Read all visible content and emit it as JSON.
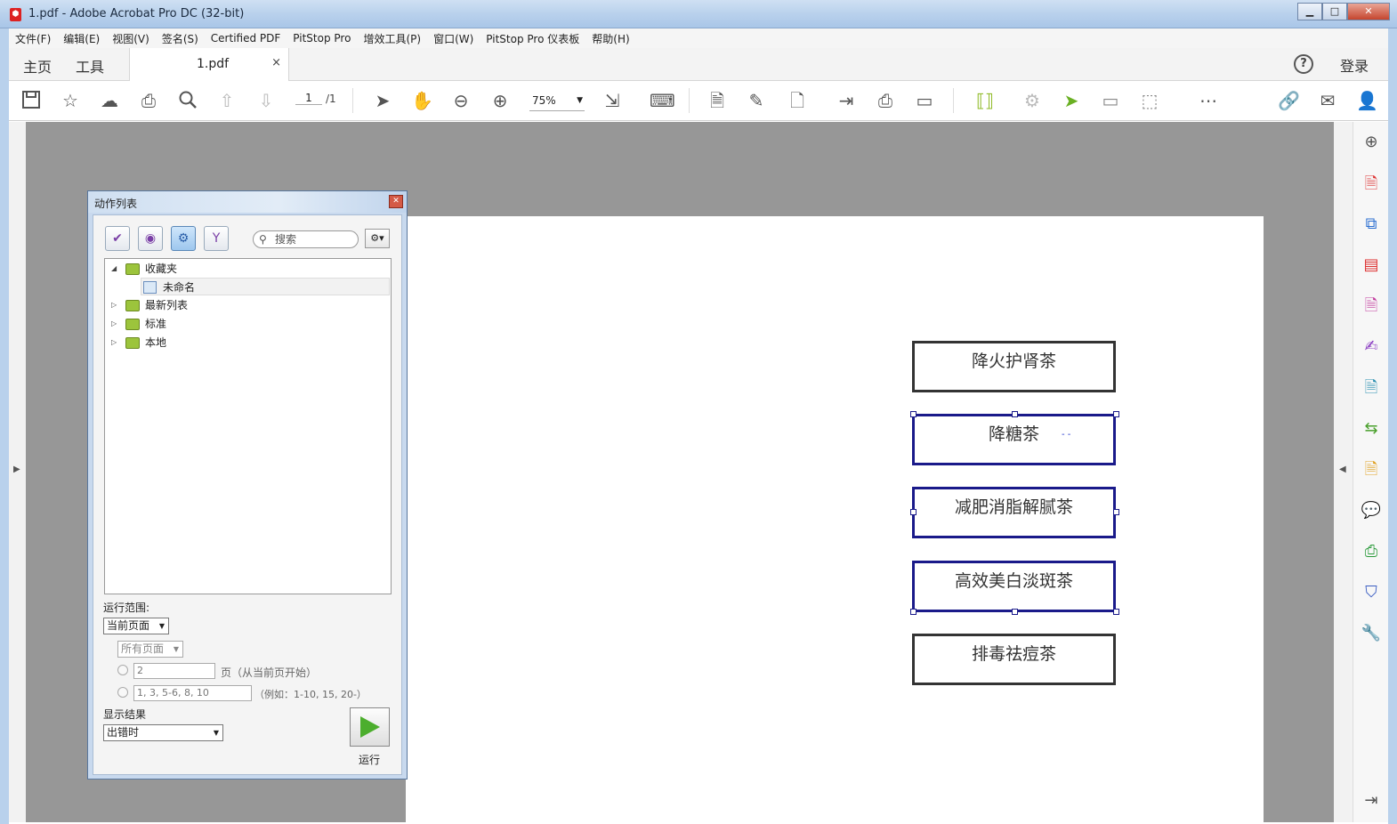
{
  "window": {
    "title": "1.pdf - Adobe Acrobat Pro DC (32-bit)",
    "min": "▁",
    "max": "□",
    "close": "✕"
  },
  "menu": [
    "文件(F)",
    "编辑(E)",
    "视图(V)",
    "签名(S)",
    "Certified PDF",
    "PitStop Pro",
    "增效工具(P)",
    "窗口(W)",
    "PitStop Pro 仪表板",
    "帮助(H)"
  ],
  "tabs": {
    "home": "主页",
    "tools": "工具",
    "doc": "1.pdf",
    "doc_close": "×",
    "help": "?",
    "login": "登录"
  },
  "toolbar": {
    "page_current": "1",
    "page_total": "/1",
    "zoom": "75%"
  },
  "page": {
    "boxes": [
      "降火护肾茶",
      "降糖茶",
      "减肥消脂解腻茶",
      "高效美白淡斑茶",
      "排毒祛痘茶"
    ]
  },
  "dialog": {
    "title": "动作列表",
    "close": "✕",
    "search_placeholder": "搜索",
    "tree": [
      {
        "label": "收藏夹",
        "expanded": true
      },
      {
        "label": "未命名",
        "child": true
      },
      {
        "label": "最新列表"
      },
      {
        "label": "标准"
      },
      {
        "label": "本地"
      }
    ],
    "run_scope_label": "运行范围:",
    "scope_select": "当前页面",
    "pages_select": "所有页面",
    "pages_count": "2",
    "pages_count_suffix": "页（从当前页开始）",
    "pages_list": "1, 3, 5-6, 8, 10",
    "pages_list_hint": "（例如：1-10, 15, 20-）",
    "show_results_label": "显示结果",
    "show_results_select": "出错时",
    "run_label": "运行"
  },
  "colors": {
    "accent": "#1a1a8a",
    "workspace": "#979797",
    "run_green": "#4cae2d"
  }
}
